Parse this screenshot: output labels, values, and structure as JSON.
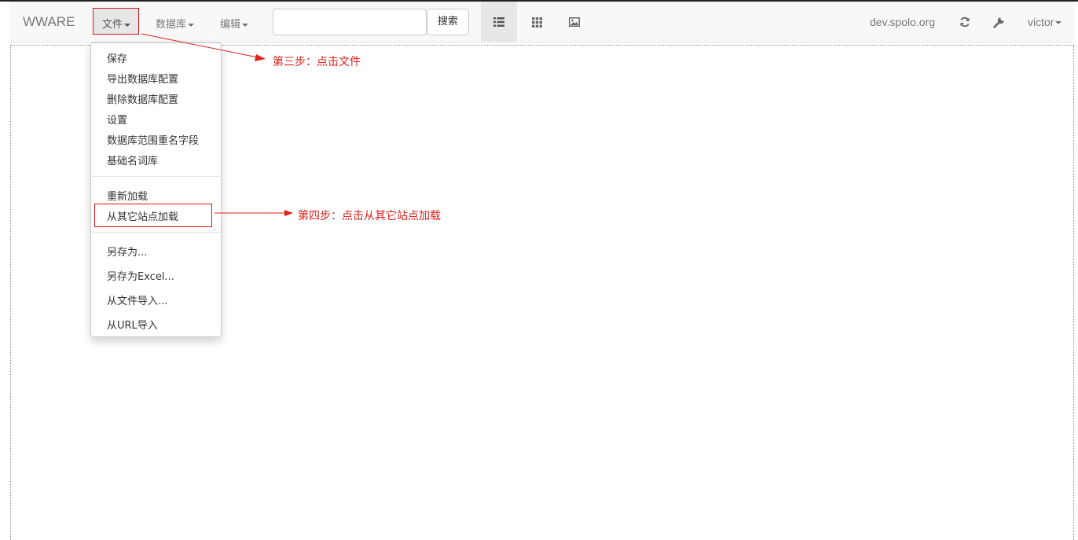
{
  "navbar": {
    "brand": "WWARE",
    "menus": [
      {
        "label": "文件"
      },
      {
        "label": "数据库"
      },
      {
        "label": "编辑"
      }
    ],
    "search": {
      "placeholder": "",
      "value": "",
      "button_label": "搜索"
    },
    "view_buttons": [
      {
        "icon": "list-icon",
        "active": true
      },
      {
        "icon": "grid-icon",
        "active": false
      },
      {
        "icon": "image-icon",
        "active": false
      }
    ],
    "host": "dev.spolo.org",
    "refresh_icon": "refresh-icon",
    "settings_icon": "wrench-icon",
    "user": "victor"
  },
  "file_menu": {
    "group1": [
      "保存",
      "导出数据库配置",
      "删除数据库配置",
      "设置",
      "数据库范围重名字段",
      "基础名词库"
    ],
    "group2": [
      "重新加载",
      "从其它站点加载"
    ],
    "group3": [
      "另存为...",
      "另存为Excel...",
      "从文件导入...",
      "从URL导入"
    ]
  },
  "annotations": {
    "step3": "第三步：点击文件",
    "step4": "第四步：点击从其它站点加载"
  },
  "colors": {
    "annotation": "#e0201a",
    "navbar_bg": "#f8f8f8",
    "active_bg": "#e7e7e7"
  }
}
